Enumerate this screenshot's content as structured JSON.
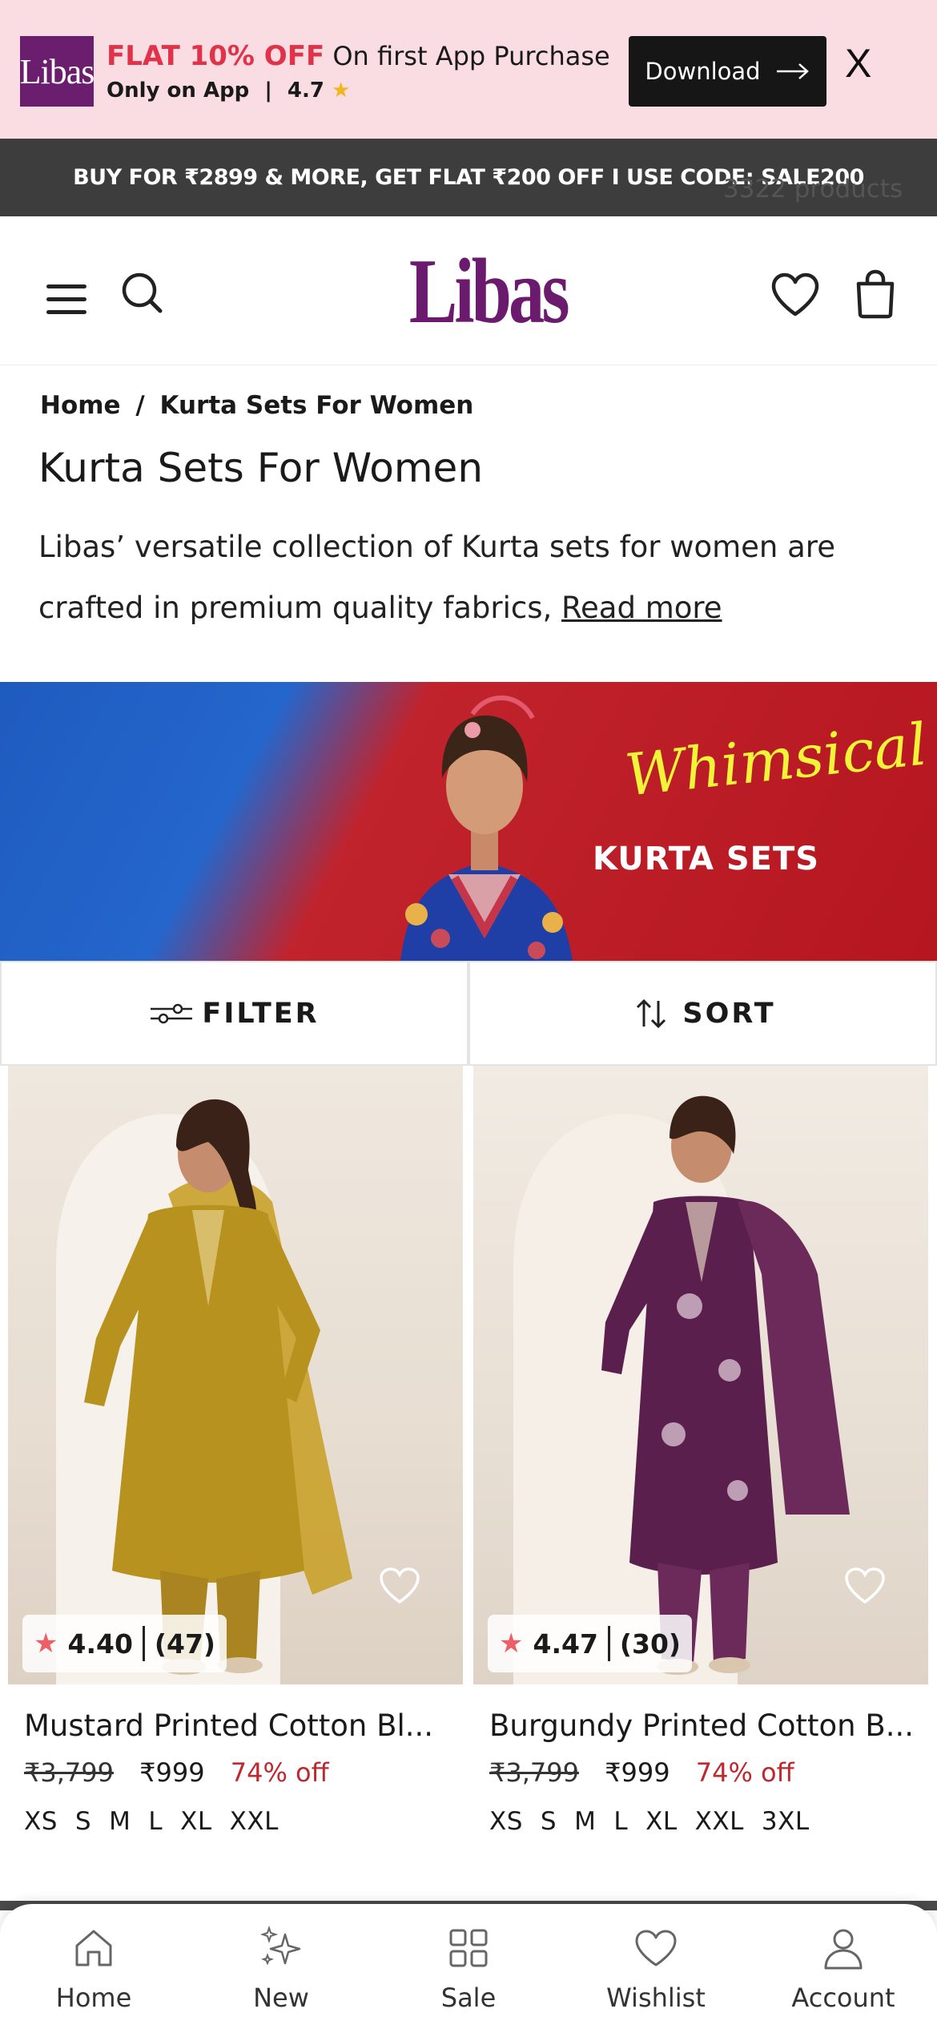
{
  "app_banner": {
    "logo_text": "Libas",
    "highlight": "FLAT 10% OFF",
    "tagline": "On first App Purchase",
    "only_on_app": "Only on App",
    "separator": "|",
    "rating": "4.7",
    "star": "★",
    "download_label": "Download",
    "close_label": "X"
  },
  "announcement": {
    "text": "BUY FOR ₹2899 & MORE, GET FLAT ₹200 OFF I USE CODE: SALE200",
    "product_count": "3322 products"
  },
  "header": {
    "brand": "Libas"
  },
  "breadcrumb": {
    "home": "Home",
    "separator": "/",
    "current": "Kurta Sets For Women"
  },
  "page": {
    "title": "Kurta Sets For Women",
    "description": "Libas’ versatile collection of Kurta sets for women are crafted in premium quality fabrics, ",
    "read_more": "Read more"
  },
  "hero": {
    "script_text": "Whimsical",
    "caps_text": "KURTA SETS"
  },
  "controls": {
    "filter_label": "FILTER",
    "sort_label": "SORT"
  },
  "products": [
    {
      "name": "Mustard Printed Cotton Bl...",
      "rating": "4.40",
      "reviews": "(47)",
      "mrp": "₹3,799",
      "price": "₹999",
      "discount": "74% off",
      "sizes": [
        "XS",
        "S",
        "M",
        "L",
        "XL",
        "XXL"
      ],
      "color": "#b8921f"
    },
    {
      "name": "Burgundy Printed Cotton B...",
      "rating": "4.47",
      "reviews": "(30)",
      "mrp": "₹3,799",
      "price": "₹999",
      "discount": "74% off",
      "sizes": [
        "XS",
        "S",
        "M",
        "L",
        "XL",
        "XXL",
        "3XL"
      ],
      "color": "#5b1f4d"
    }
  ],
  "bottom_nav": [
    {
      "label": "Home",
      "icon": "home-icon"
    },
    {
      "label": "New",
      "icon": "sparkle-icon"
    },
    {
      "label": "Sale",
      "icon": "grid-icon"
    },
    {
      "label": "Wishlist",
      "icon": "heart-icon"
    },
    {
      "label": "Account",
      "icon": "user-icon"
    }
  ],
  "colors": {
    "brand": "#6a1b6d",
    "promo_red": "#e0334a",
    "discount_red": "#c0282f",
    "rating_star": "#ec5f68"
  }
}
